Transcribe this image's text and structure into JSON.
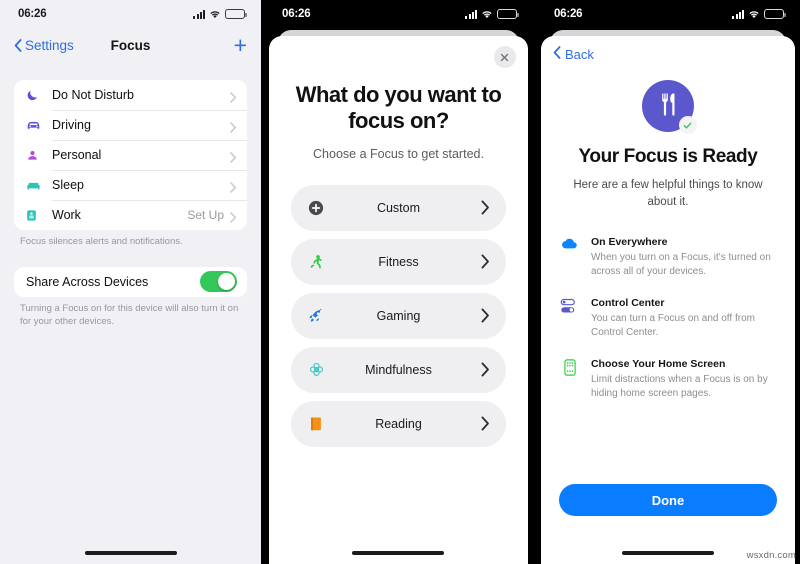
{
  "status_bar": {
    "time": "06:26",
    "cellular": "signal-bars",
    "wifi": "wifi-icon",
    "battery": "battery-low-icon"
  },
  "panel_settings": {
    "nav": {
      "back_label": "Settings",
      "title": "Focus",
      "add_label": "+"
    },
    "focus_items": [
      {
        "label": "Do Not Disturb",
        "icon": "moon-icon",
        "color": "#5b52d8",
        "aux": ""
      },
      {
        "label": "Driving",
        "icon": "car-icon",
        "color": "#5b52d8",
        "aux": ""
      },
      {
        "label": "Personal",
        "icon": "person-icon",
        "color": "#b44be0",
        "aux": ""
      },
      {
        "label": "Sleep",
        "icon": "bed-icon",
        "color": "#2bc4b8",
        "aux": ""
      },
      {
        "label": "Work",
        "icon": "badge-icon",
        "color": "#2bc4b8",
        "aux": "Set Up"
      }
    ],
    "focus_note": "Focus silences alerts and notifications.",
    "share": {
      "label": "Share Across Devices",
      "toggle_state": "on",
      "toggle_color": "#34c759",
      "note": "Turning a Focus on for this device will also turn it on for your other devices."
    }
  },
  "panel_chooser": {
    "close_label": "close-icon",
    "title": "What do you want to focus on?",
    "subtitle": "Choose a Focus to get started.",
    "options": [
      {
        "label": "Custom",
        "icon": "plus-circle-icon",
        "color": "#5a5a5e"
      },
      {
        "label": "Fitness",
        "icon": "running-person-icon",
        "color": "#2ecc40"
      },
      {
        "label": "Gaming",
        "icon": "rocket-icon",
        "color": "#1f7ae0"
      },
      {
        "label": "Mindfulness",
        "icon": "lotus-icon",
        "color": "#3fc6c0"
      },
      {
        "label": "Reading",
        "icon": "book-icon",
        "color": "#f59016"
      }
    ]
  },
  "panel_ready": {
    "back_label": "Back",
    "badge_icon": "fork-knife-icon",
    "badge_color": "#5a58cc",
    "check_color": "#34c759",
    "title": "Your Focus is Ready",
    "subtitle": "Here are a few helpful things to know about it.",
    "tips": [
      {
        "title": "On Everywhere",
        "body": "When you turn on a Focus, it's turned on across all of your devices.",
        "icon": "cloud-icon",
        "color": "#0a84ff"
      },
      {
        "title": "Control Center",
        "body": "You can turn a Focus on and off from Control Center.",
        "icon": "toggles-icon",
        "color": "#5a58cc"
      },
      {
        "title": "Choose Your Home Screen",
        "body": "Limit distractions when a Focus is on by hiding home screen pages.",
        "icon": "home-screen-icon",
        "color": "#2ecc40"
      }
    ],
    "done_label": "Done",
    "done_color": "#0a7cff"
  },
  "watermark": "wsxdn.com"
}
